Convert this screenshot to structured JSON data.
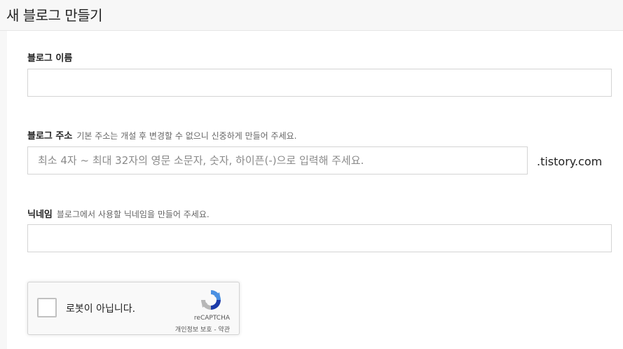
{
  "header": {
    "title": "새 블로그 만들기"
  },
  "form": {
    "blog_name": {
      "label": "블로그 이름",
      "value": "",
      "placeholder": ""
    },
    "blog_address": {
      "label": "블로그 주소",
      "hint": "기본 주소는 개설 후 변경할 수 없으니 신중하게 만들어 주세요.",
      "placeholder": "최소 4자 ~ 최대 32자의 영문 소문자, 숫자, 하이픈(-)으로 입력해 주세요.",
      "value": "",
      "suffix": ".tistory.com"
    },
    "nickname": {
      "label": "닉네임",
      "hint": "블로그에서 사용할 닉네임을 만들어 주세요.",
      "value": "",
      "placeholder": ""
    }
  },
  "captcha": {
    "label": "로봇이 아닙니다.",
    "brand": "reCAPTCHA",
    "links": "개인정보 보호 - 약관",
    "checked": false,
    "logo_icon": "recaptcha-logo-icon",
    "colors": {
      "blue": "#4a90e2",
      "dark_blue": "#1c3aa9",
      "gray": "#b7b7b7"
    }
  }
}
